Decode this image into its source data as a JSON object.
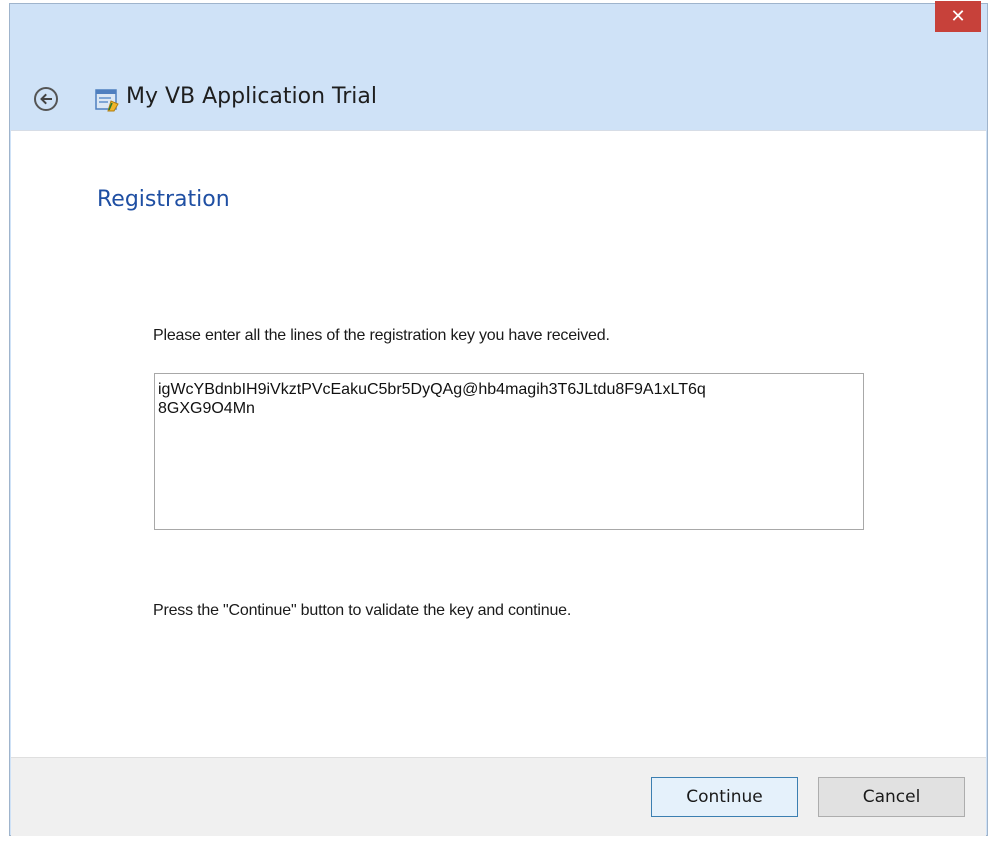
{
  "window": {
    "title": "My VB Application Trial",
    "close_label": "✕"
  },
  "page": {
    "heading": "Registration",
    "instruction": "Please enter all the lines of the registration key you have received.",
    "key_value": "igWcYBdnbIH9iVkztPVcEakuC5br5DyQAg@hb4magih3T6JLtdu8F9A1xLT6q\n8GXG9O4Mn",
    "continue_instruction": "Press the \"Continue\" button to validate the key and continue."
  },
  "buttons": {
    "continue_label": "Continue",
    "cancel_label": "Cancel"
  },
  "colors": {
    "titlebar_bg": "#cfe2f7",
    "close_bg": "#c7413a",
    "heading": "#1f4fa3",
    "primary_border": "#3c7fb1"
  },
  "icons": {
    "back": "back-arrow-icon",
    "app": "application-icon",
    "close": "close-icon"
  }
}
